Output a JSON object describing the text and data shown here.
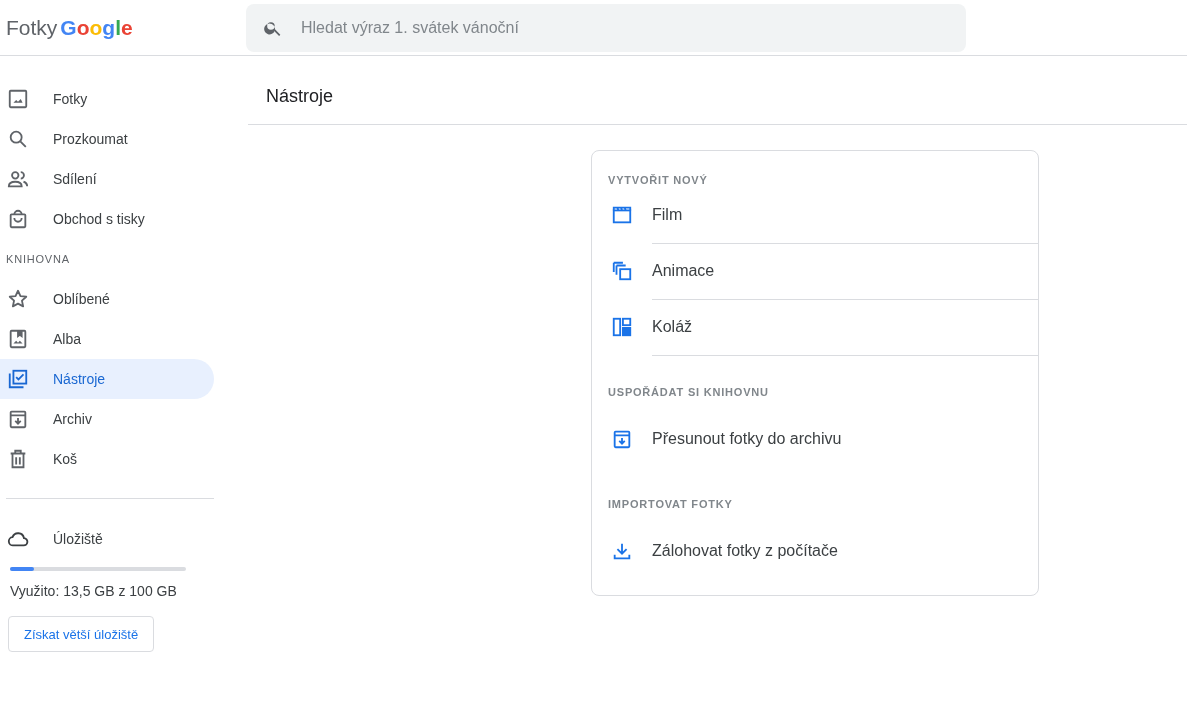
{
  "header": {
    "logo": {
      "product": "Fotky",
      "brand": "Google"
    },
    "search": {
      "placeholder": "Hledat výraz 1. svátek vánoční"
    }
  },
  "sidebar": {
    "items": [
      {
        "label": "Fotky",
        "selected": false
      },
      {
        "label": "Prozkoumat",
        "selected": false
      },
      {
        "label": "Sdílení",
        "selected": false
      },
      {
        "label": "Obchod s tisky",
        "selected": false
      }
    ],
    "library_heading": "KNIHOVNA",
    "library_items": [
      {
        "label": "Oblíbené",
        "selected": false
      },
      {
        "label": "Alba",
        "selected": false
      },
      {
        "label": "Nástroje",
        "selected": true
      },
      {
        "label": "Archiv",
        "selected": false
      },
      {
        "label": "Koš",
        "selected": false
      }
    ],
    "storage": {
      "label": "Úložiště",
      "level": 0.135,
      "usage": "Využito: 13,5 GB z 100 GB",
      "button": "Získat větší úložiště"
    }
  },
  "main": {
    "title": "Nástroje",
    "sections": [
      {
        "heading": "VYTVOŘIT NOVÝ",
        "items": [
          "Film",
          "Animace",
          "Koláž"
        ]
      },
      {
        "heading": "USPOŘÁDAT SI KNIHOVNU",
        "items": [
          "Přesunout fotky do archivu"
        ]
      },
      {
        "heading": "IMPORTOVAT FOTKY",
        "items": [
          "Zálohovat fotky z počítače"
        ]
      }
    ]
  }
}
